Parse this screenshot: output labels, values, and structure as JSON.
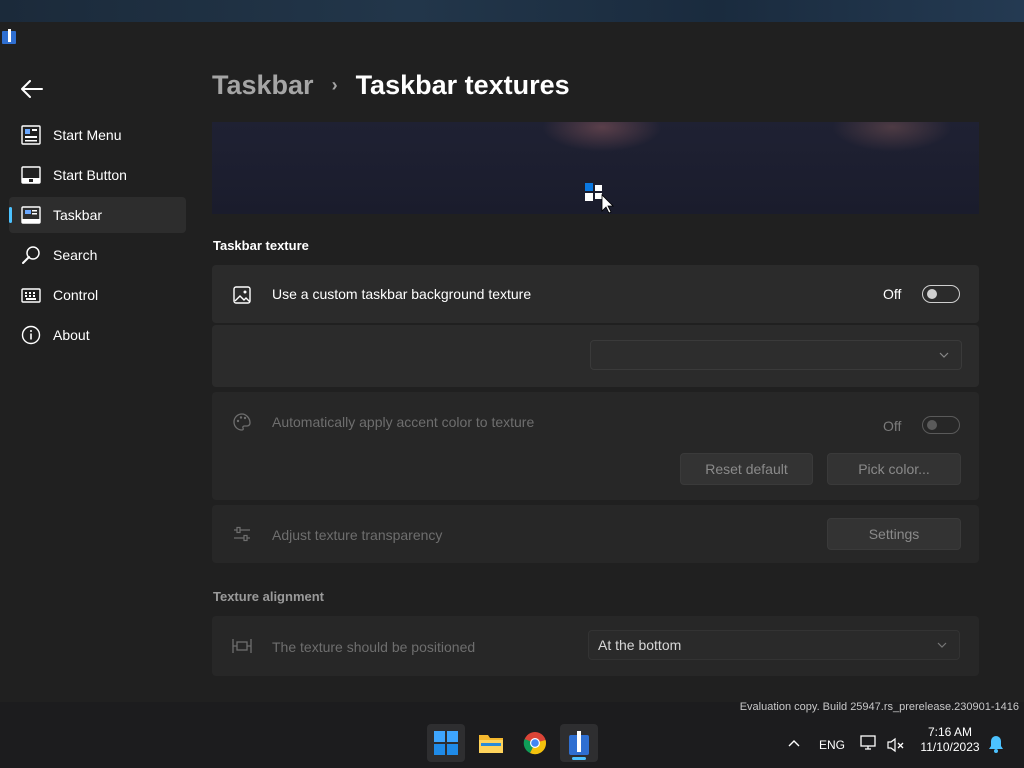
{
  "header": {
    "breadcrumb_parent": "Taskbar",
    "breadcrumb_separator": "›",
    "breadcrumb_current": "Taskbar textures"
  },
  "sidebar": {
    "items": [
      {
        "label": "Start Menu",
        "icon": "start-menu-icon",
        "active": false
      },
      {
        "label": "Start Button",
        "icon": "start-button-icon",
        "active": false
      },
      {
        "label": "Taskbar",
        "icon": "taskbar-icon",
        "active": true
      },
      {
        "label": "Search",
        "icon": "search-icon",
        "active": false
      },
      {
        "label": "Control",
        "icon": "keyboard-icon",
        "active": false
      },
      {
        "label": "About",
        "icon": "info-icon",
        "active": false
      }
    ]
  },
  "texture_section": {
    "title": "Taskbar texture",
    "custom_texture": {
      "label": "Use a custom taskbar background texture",
      "state": "Off"
    },
    "texture_select": {
      "value": ""
    },
    "accent": {
      "label": "Automatically apply accent color to texture",
      "state": "Off"
    },
    "reset_button": "Reset default",
    "pick_color_button": "Pick color...",
    "transparency": {
      "label": "Adjust texture transparency",
      "button": "Settings"
    }
  },
  "alignment_section": {
    "title": "Texture alignment",
    "position_label": "The texture should be positioned",
    "position_value": "At the bottom"
  },
  "system": {
    "watermark": "Evaluation copy. Build 25947.rs_prerelease.230901-1416",
    "language": "ENG",
    "time": "7:16 AM",
    "date": "11/10/2023"
  },
  "colors": {
    "accent": "#4cc2ff",
    "background": "#202020",
    "card": "#2b2b2b"
  }
}
